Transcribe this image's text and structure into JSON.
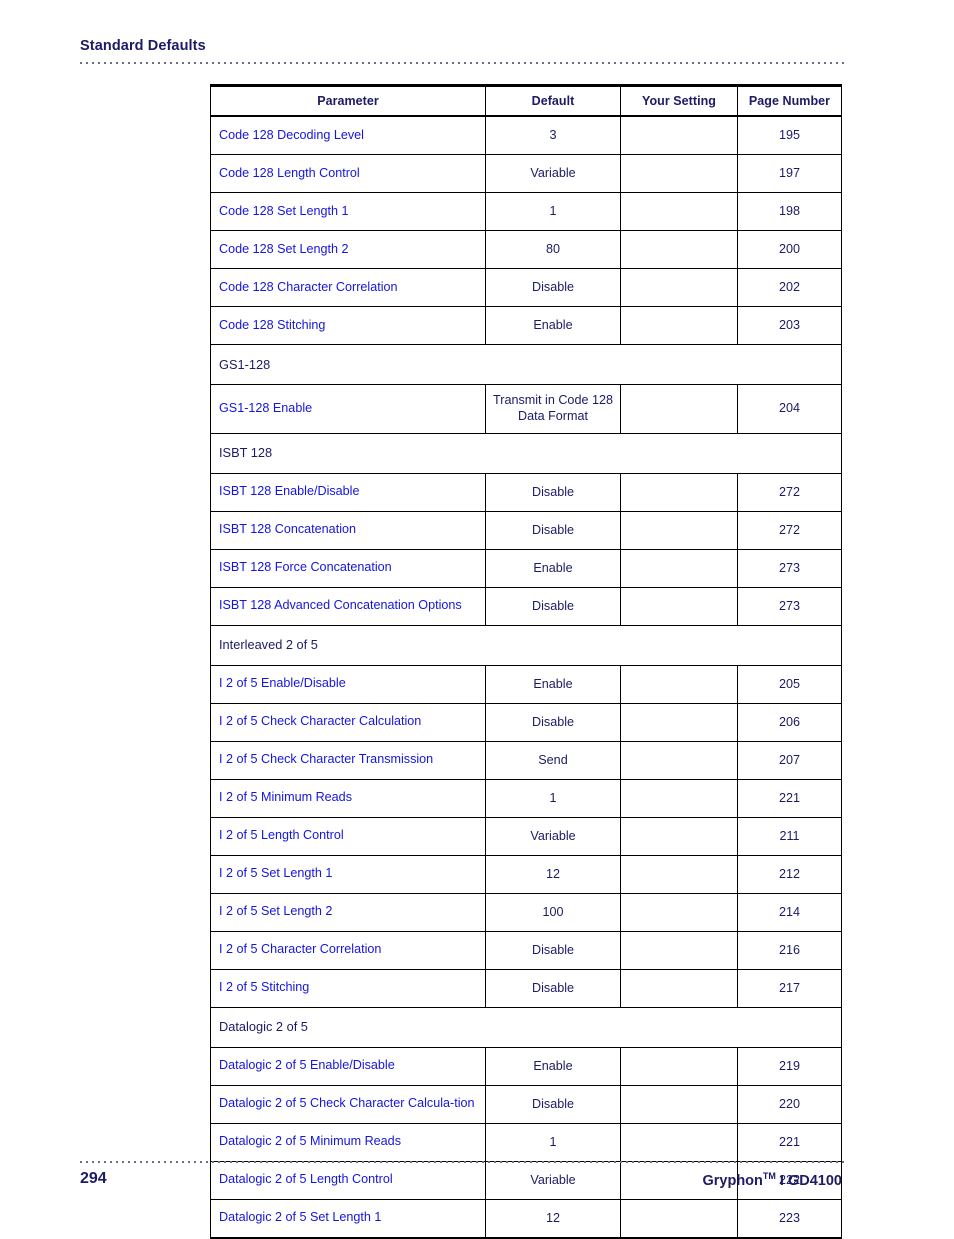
{
  "running_head": "Standard Defaults",
  "colors": {
    "link_blue": "#1515e0",
    "navy": "#1b1b66",
    "rule": "#6d6d8a",
    "border": "#000000"
  },
  "table": {
    "headers": {
      "parameter": "Parameter",
      "default": "Default",
      "your_setting": "Your Setting",
      "page_number": "Page Number"
    },
    "rows": [
      {
        "kind": "item",
        "parameter": "Code 128 Decoding Level",
        "default": "3",
        "your_setting": "",
        "page": "195"
      },
      {
        "kind": "item",
        "parameter": "Code 128 Length Control",
        "default": "Variable",
        "your_setting": "",
        "page": "197"
      },
      {
        "kind": "item",
        "parameter": "Code 128 Set Length 1",
        "default": "1",
        "your_setting": "",
        "page": "198"
      },
      {
        "kind": "item",
        "parameter": "Code 128 Set Length 2",
        "default": "80",
        "your_setting": "",
        "page": "200"
      },
      {
        "kind": "item",
        "parameter": "Code 128 Character Correlation",
        "default": "Disable",
        "your_setting": "",
        "page": "202"
      },
      {
        "kind": "item",
        "parameter": "Code 128 Stitching",
        "default": "Enable",
        "your_setting": "",
        "page": "203"
      },
      {
        "kind": "section",
        "parameter": "GS1-128"
      },
      {
        "kind": "item",
        "parameter": "GS1-128 Enable",
        "default": "Transmit in Code 128 Data Format",
        "your_setting": "",
        "page": "204"
      },
      {
        "kind": "section",
        "parameter": "ISBT 128"
      },
      {
        "kind": "item",
        "parameter": "ISBT 128 Enable/Disable",
        "default": "Disable",
        "your_setting": "",
        "page": "272"
      },
      {
        "kind": "item",
        "parameter": "ISBT 128 Concatenation",
        "default": "Disable",
        "your_setting": "",
        "page": "272"
      },
      {
        "kind": "item",
        "parameter": "ISBT 128 Force Concatenation",
        "default": "Enable",
        "your_setting": "",
        "page": "273"
      },
      {
        "kind": "item",
        "parameter": "ISBT 128 Advanced Concatenation Options",
        "default": "Disable",
        "your_setting": "",
        "page": "273"
      },
      {
        "kind": "section",
        "parameter": "Interleaved 2 of 5"
      },
      {
        "kind": "item",
        "parameter": "I 2 of 5 Enable/Disable",
        "default": "Enable",
        "your_setting": "",
        "page": "205"
      },
      {
        "kind": "item",
        "parameter": "I 2 of 5 Check Character Calculation",
        "default": "Disable",
        "your_setting": "",
        "page": "206"
      },
      {
        "kind": "item",
        "parameter": "I 2 of 5 Check Character Transmission",
        "default": "Send",
        "your_setting": "",
        "page": "207"
      },
      {
        "kind": "item",
        "parameter": "I 2 of 5 Minimum Reads",
        "default": "1",
        "your_setting": "",
        "page": "221"
      },
      {
        "kind": "item",
        "parameter": "I 2 of 5 Length Control",
        "default": "Variable",
        "your_setting": "",
        "page": "211"
      },
      {
        "kind": "item",
        "parameter": "I 2 of 5 Set Length 1",
        "default": "12",
        "your_setting": "",
        "page": "212"
      },
      {
        "kind": "item",
        "parameter": "I 2 of 5 Set Length 2",
        "default": "100",
        "your_setting": "",
        "page": "214"
      },
      {
        "kind": "item",
        "parameter": "I 2 of 5 Character Correlation",
        "default": "Disable",
        "your_setting": "",
        "page": "216"
      },
      {
        "kind": "item",
        "parameter": "I 2 of 5 Stitching",
        "default": "Disable",
        "your_setting": "",
        "page": "217"
      },
      {
        "kind": "section",
        "parameter": "Datalogic 2 of 5"
      },
      {
        "kind": "item",
        "parameter": "Datalogic 2 of 5 Enable/Disable",
        "default": "Enable",
        "your_setting": "",
        "page": "219"
      },
      {
        "kind": "item",
        "parameter": "Datalogic 2 of 5 Check Character Calcula-tion",
        "default": "Disable",
        "your_setting": "",
        "page": "220"
      },
      {
        "kind": "item",
        "parameter": "Datalogic 2 of 5 Minimum Reads",
        "default": "1",
        "your_setting": "",
        "page": "221"
      },
      {
        "kind": "item",
        "parameter": "Datalogic 2 of 5 Length Control",
        "default": "Variable",
        "your_setting": "",
        "page": "222"
      },
      {
        "kind": "item",
        "parameter": "Datalogic 2 of 5 Set Length 1",
        "default": "12",
        "your_setting": "",
        "page": "223"
      }
    ]
  },
  "footer": {
    "folio": "294",
    "product_name": "Gryphon",
    "trademark": "TM",
    "model": " I GD4100"
  }
}
